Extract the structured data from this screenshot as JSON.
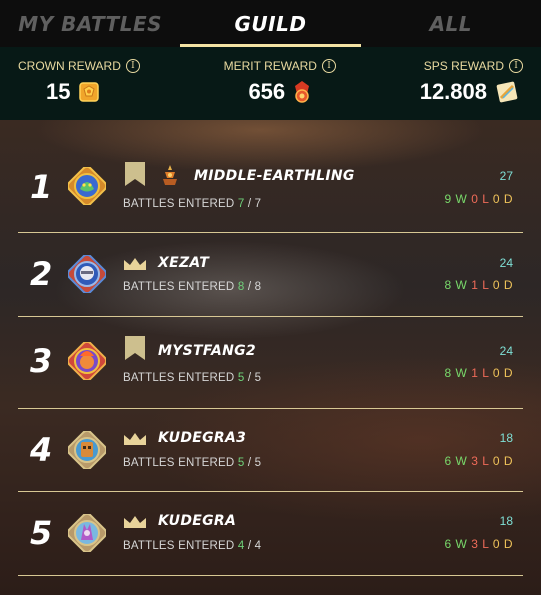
{
  "tabs": [
    {
      "label": "MY BATTLES",
      "active": false
    },
    {
      "label": "GUILD",
      "active": true
    },
    {
      "label": "ALL",
      "active": false
    }
  ],
  "rewards": {
    "crown": {
      "label": "CROWN REWARD",
      "value": "15",
      "icon": "crown-token-icon"
    },
    "merit": {
      "label": "MERIT REWARD",
      "value": "656",
      "icon": "merit-token-icon"
    },
    "sps": {
      "label": "SPS REWARD",
      "value": "12.808",
      "icon": "sps-token-icon"
    }
  },
  "info_glyph": "i",
  "battles_entered_label": "BATTLES ENTERED",
  "colors": {
    "accent": "#f3e3a4",
    "win": "#78d86a",
    "loss": "#ef6b59",
    "draw": "#efc35a",
    "score": "#7fe0d6"
  },
  "players": [
    {
      "rank": "1",
      "name": "MIDDLE-EARTHLING",
      "flag": "banner",
      "extra_icon": "guild-rank-icon",
      "entered": "7",
      "total": "7",
      "score": "27",
      "w": "9 W",
      "l": "0 L",
      "d": "0 D"
    },
    {
      "rank": "2",
      "name": "XEZAT",
      "flag": "crown",
      "entered": "8",
      "total": "8",
      "score": "24",
      "w": "8 W",
      "l": "1 L",
      "d": "0 D"
    },
    {
      "rank": "3",
      "name": "MYSTFANG2",
      "flag": "banner",
      "entered": "5",
      "total": "5",
      "score": "24",
      "w": "8 W",
      "l": "1 L",
      "d": "0 D"
    },
    {
      "rank": "4",
      "name": "KUDEGRA3",
      "flag": "crown",
      "entered": "5",
      "total": "5",
      "score": "18",
      "w": "6 W",
      "l": "3 L",
      "d": "0 D"
    },
    {
      "rank": "5",
      "name": "KUDEGRA",
      "flag": "crown",
      "entered": "4",
      "total": "4",
      "score": "18",
      "w": "6 W",
      "l": "3 L",
      "d": "0 D"
    }
  ]
}
